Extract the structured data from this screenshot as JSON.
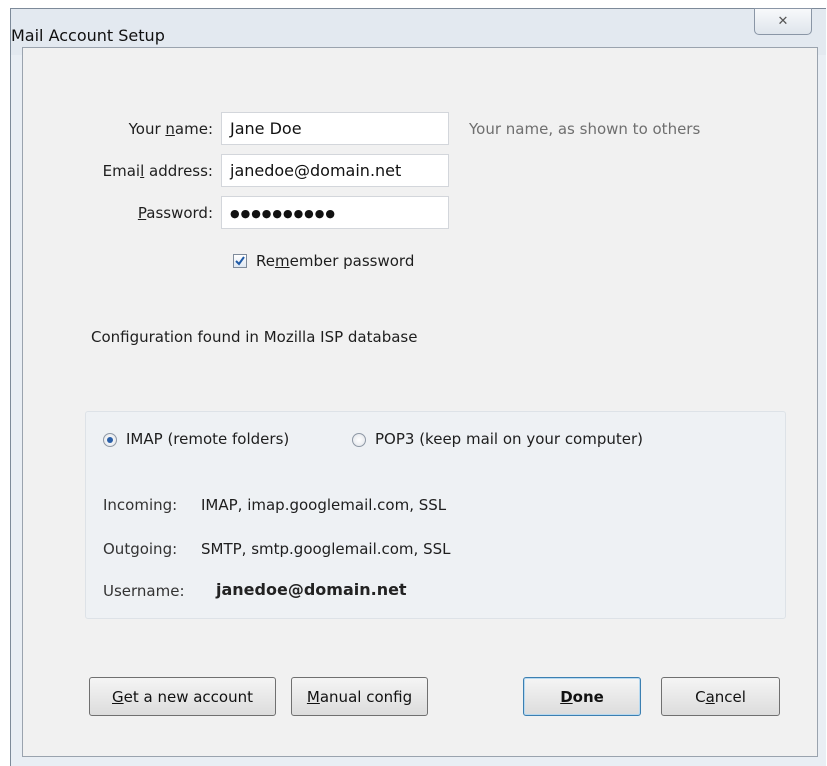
{
  "window": {
    "title": "Mail Account Setup",
    "close_symbol": "✕"
  },
  "form": {
    "name_label_pre": "Your ",
    "name_label_key": "n",
    "name_label_post": "ame:",
    "name_value": "Jane Doe",
    "name_hint": "Your name, as shown to others",
    "email_label_pre": "Emai",
    "email_label_key": "l",
    "email_label_post": " address:",
    "email_value": "janedoe@domain.net",
    "password_label_key": "P",
    "password_label_post": "assword:",
    "password_value": "●●●●●●●●●●",
    "remember_pre": "Re",
    "remember_key": "m",
    "remember_post": "ember password",
    "remember_checked": true
  },
  "status": {
    "message": "Configuration found in Mozilla ISP database"
  },
  "config": {
    "imap_label": "IMAP (remote folders)",
    "pop3_label": "POP3 (keep mail on your computer)",
    "selected": "IMAP",
    "incoming_label": "Incoming:",
    "incoming_value": "IMAP, imap.googlemail.com, SSL",
    "outgoing_label": "Outgoing:",
    "outgoing_value": "SMTP, smtp.googlemail.com, SSL",
    "username_label": "Username:",
    "username_value": "janedoe@domain.net"
  },
  "buttons": {
    "new_account_key": "G",
    "new_account_post": "et a new account",
    "manual_key": "M",
    "manual_post": "anual config",
    "done_key": "D",
    "done_post": "one",
    "cancel_pre": "C",
    "cancel_key": "a",
    "cancel_post": "ncel"
  },
  "colors": {
    "check_mark": "#1f5aa6",
    "radio_dot": "#2a5fa8"
  }
}
